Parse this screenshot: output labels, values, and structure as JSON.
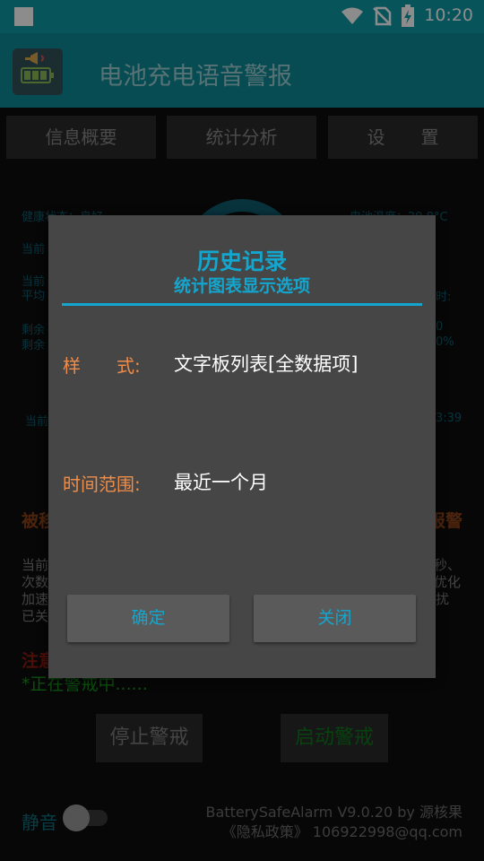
{
  "status_bar": {
    "time": "10:20"
  },
  "app_bar": {
    "title": "电池充电语音警报"
  },
  "tabs": [
    {
      "label": "信息概要"
    },
    {
      "label": "统计分析"
    },
    {
      "label": "设　　置"
    }
  ],
  "background": {
    "health_status": "健康状态：良好",
    "battery_temp": "电池温度：29.8°C",
    "row_current": "当前",
    "row_current2": "当前",
    "row_avg": "平均",
    "row_remaining": "剩余",
    "row_remaining2": "剩余",
    "right_suffix_1": "时:",
    "right_suffix_2": "0",
    "right_suffix_3": "0%",
    "row_current3": "当前",
    "right_time": "3:39",
    "passive_left": "被移",
    "passive_right": "报警",
    "note_line1": "当前",
    "note_line2": "次数",
    "note_line3": "加速",
    "note_line4": "已关",
    "note_right1": "秒、",
    "note_right2": "优化",
    "note_right3": "扰",
    "warning_prefix": "注意",
    "alert_status": "*正在警戒中......",
    "stop_button": "停止警戒",
    "start_button": "启动警戒",
    "mute_label": "静音",
    "version_line": "BatterySafeAlarm V9.0.20 by 源核果",
    "policy_line": "《隐私政策》 106922998@qq.com"
  },
  "dialog": {
    "title": "历史记录",
    "subtitle": "统计图表显示选项",
    "style_label": "样　　式:",
    "style_value": "文字板列表[全数据项]",
    "range_label": "时间范围:",
    "range_value": "最近一个月",
    "ok_button": "确定",
    "close_button": "关闭"
  }
}
